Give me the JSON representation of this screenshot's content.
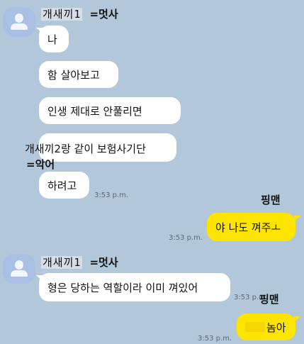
{
  "chat": {
    "sender_name": "개새끼1",
    "sender_alias": "=멋사",
    "second_friend_name": "개새끼2",
    "second_friend_alias": "=악어",
    "my_alias": "핑맨",
    "messages": [
      {
        "from": "them",
        "text": "나"
      },
      {
        "from": "them",
        "text": "함 살아보고"
      },
      {
        "from": "them",
        "text": "인생 제대로 안풀리면"
      },
      {
        "from": "them",
        "text_suffix": "랑 같이 보험사기단"
      },
      {
        "from": "them",
        "text": "하려고",
        "time": "3:53 p.m."
      },
      {
        "from": "me",
        "text": "야 나도 껴주ㅗ",
        "time": "3:53 p.m."
      },
      {
        "from": "them",
        "text": "형은 당하는 역할이라 이미 껴있어",
        "time": "3:53 p.m."
      },
      {
        "from": "me",
        "text": "놈아",
        "time": "3:53 p.m."
      }
    ]
  },
  "colors": {
    "background": "#b2c7d9",
    "incoming_bubble": "#ffffff",
    "outgoing_bubble": "#fee500",
    "avatar": "#a9bfe3"
  },
  "icons": {
    "avatar": "default-profile-icon"
  }
}
